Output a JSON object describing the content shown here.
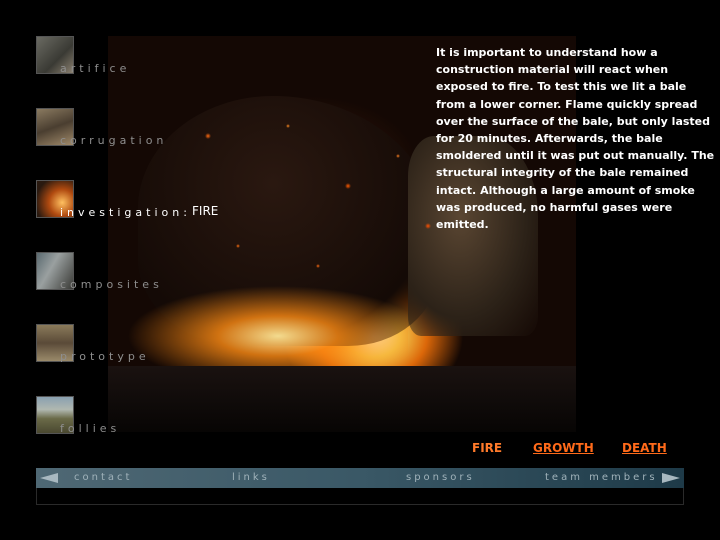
{
  "nav": {
    "items": [
      {
        "label": "artifice",
        "active": false
      },
      {
        "label": "corrugation",
        "active": false
      },
      {
        "label": "investigation:",
        "active": true,
        "sublabel": "FIRE"
      },
      {
        "label": "composites",
        "active": false
      },
      {
        "label": "prototype",
        "active": false
      },
      {
        "label": "follies",
        "active": false
      }
    ]
  },
  "main": {
    "description": "It is important to understand how a construction material will react when exposed to fire. To test this we lit a bale from a lower corner.  Flame quickly spread over the surface of the bale, but only lasted for 20 minutes. Afterwards, the bale smoldered until it was put out manually. The structural integrity of the bale remained intact.  Although a large amount of smoke was produced, no harmful gases were emitted."
  },
  "subnav": {
    "fire": "FIRE",
    "growth": "GROWTH",
    "death": "DEATH"
  },
  "footer": {
    "contact": "contact",
    "links": "links",
    "sponsors": "sponsors",
    "team_members": "team members"
  },
  "colors": {
    "background": "#000000",
    "accent": "#ff6a1a",
    "nav_text": "#8e8e8e",
    "bar": "#3a5866"
  }
}
